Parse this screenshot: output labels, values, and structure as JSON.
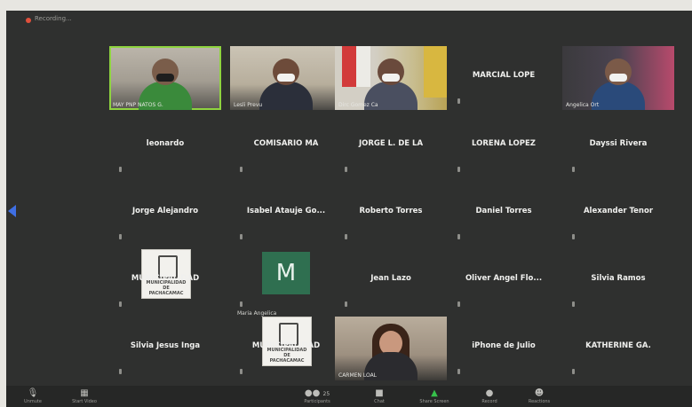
{
  "meeting": {
    "recording_label": "Recording..."
  },
  "participants": [
    {
      "name": "MAY PNP NATOS G.",
      "type": "video"
    },
    {
      "name": "Lesli Prevu",
      "type": "video"
    },
    {
      "name": "Dirc Gomez Ca",
      "type": "video"
    },
    {
      "name": "MARCIAL LOPE",
      "type": "name"
    },
    {
      "name": "Angelica Ort",
      "type": "video"
    },
    {
      "name": "leonardo",
      "type": "name"
    },
    {
      "name": "COMISARIO MA",
      "type": "name"
    },
    {
      "name": "JORGE L. DE LA",
      "type": "name"
    },
    {
      "name": "LORENA LOPEZ",
      "type": "name"
    },
    {
      "name": "Dayssi Rivera",
      "type": "name"
    },
    {
      "name": "Jorge Alejandro",
      "type": "name"
    },
    {
      "name": "Isabel Atauje Go...",
      "type": "name"
    },
    {
      "name": "Roberto Torres",
      "type": "name"
    },
    {
      "name": "Daniel Torres",
      "type": "name"
    },
    {
      "name": "Alexander Tenor",
      "type": "name"
    },
    {
      "name": "MUNICIPALIDAD",
      "type": "logo",
      "logo_text": "MUNICIPALIDAD DE PACHACAMAC"
    },
    {
      "name": "Maria Angelica",
      "type": "avatar",
      "initial": "M"
    },
    {
      "name": "Jean Lazo",
      "type": "name"
    },
    {
      "name": "Oliver Angel Flo...",
      "type": "name"
    },
    {
      "name": "Silvia Ramos",
      "type": "name"
    },
    {
      "name": "Silvia Jesus Inga",
      "type": "name"
    },
    {
      "name": "MUNICIPALIDAD",
      "type": "logo",
      "logo_text": "MUNICIPALIDAD DE PACHACAMAC"
    },
    {
      "name": "CARMEN LOAL",
      "type": "video"
    },
    {
      "name": "iPhone de Julio",
      "type": "name"
    },
    {
      "name": "KATHERINE GA.",
      "type": "name"
    }
  ],
  "toolbar": {
    "mute": {
      "label": "Unmute",
      "icon": "microphone-icon"
    },
    "video": {
      "label": "Start Video",
      "icon": "video-camera-icon"
    },
    "participants": {
      "label": "Participants",
      "count": "25",
      "icon": "participants-icon"
    },
    "chat": {
      "label": "Chat",
      "icon": "chat-icon"
    },
    "share": {
      "label": "Share Screen",
      "icon": "share-screen-icon"
    },
    "record": {
      "label": "Record",
      "icon": "record-icon"
    },
    "reactions": {
      "label": "Reactions",
      "icon": "reactions-icon"
    }
  },
  "colors": {
    "active_speaker": "#8fd43f",
    "share": "#36c14a",
    "recording": "#e0503c"
  }
}
